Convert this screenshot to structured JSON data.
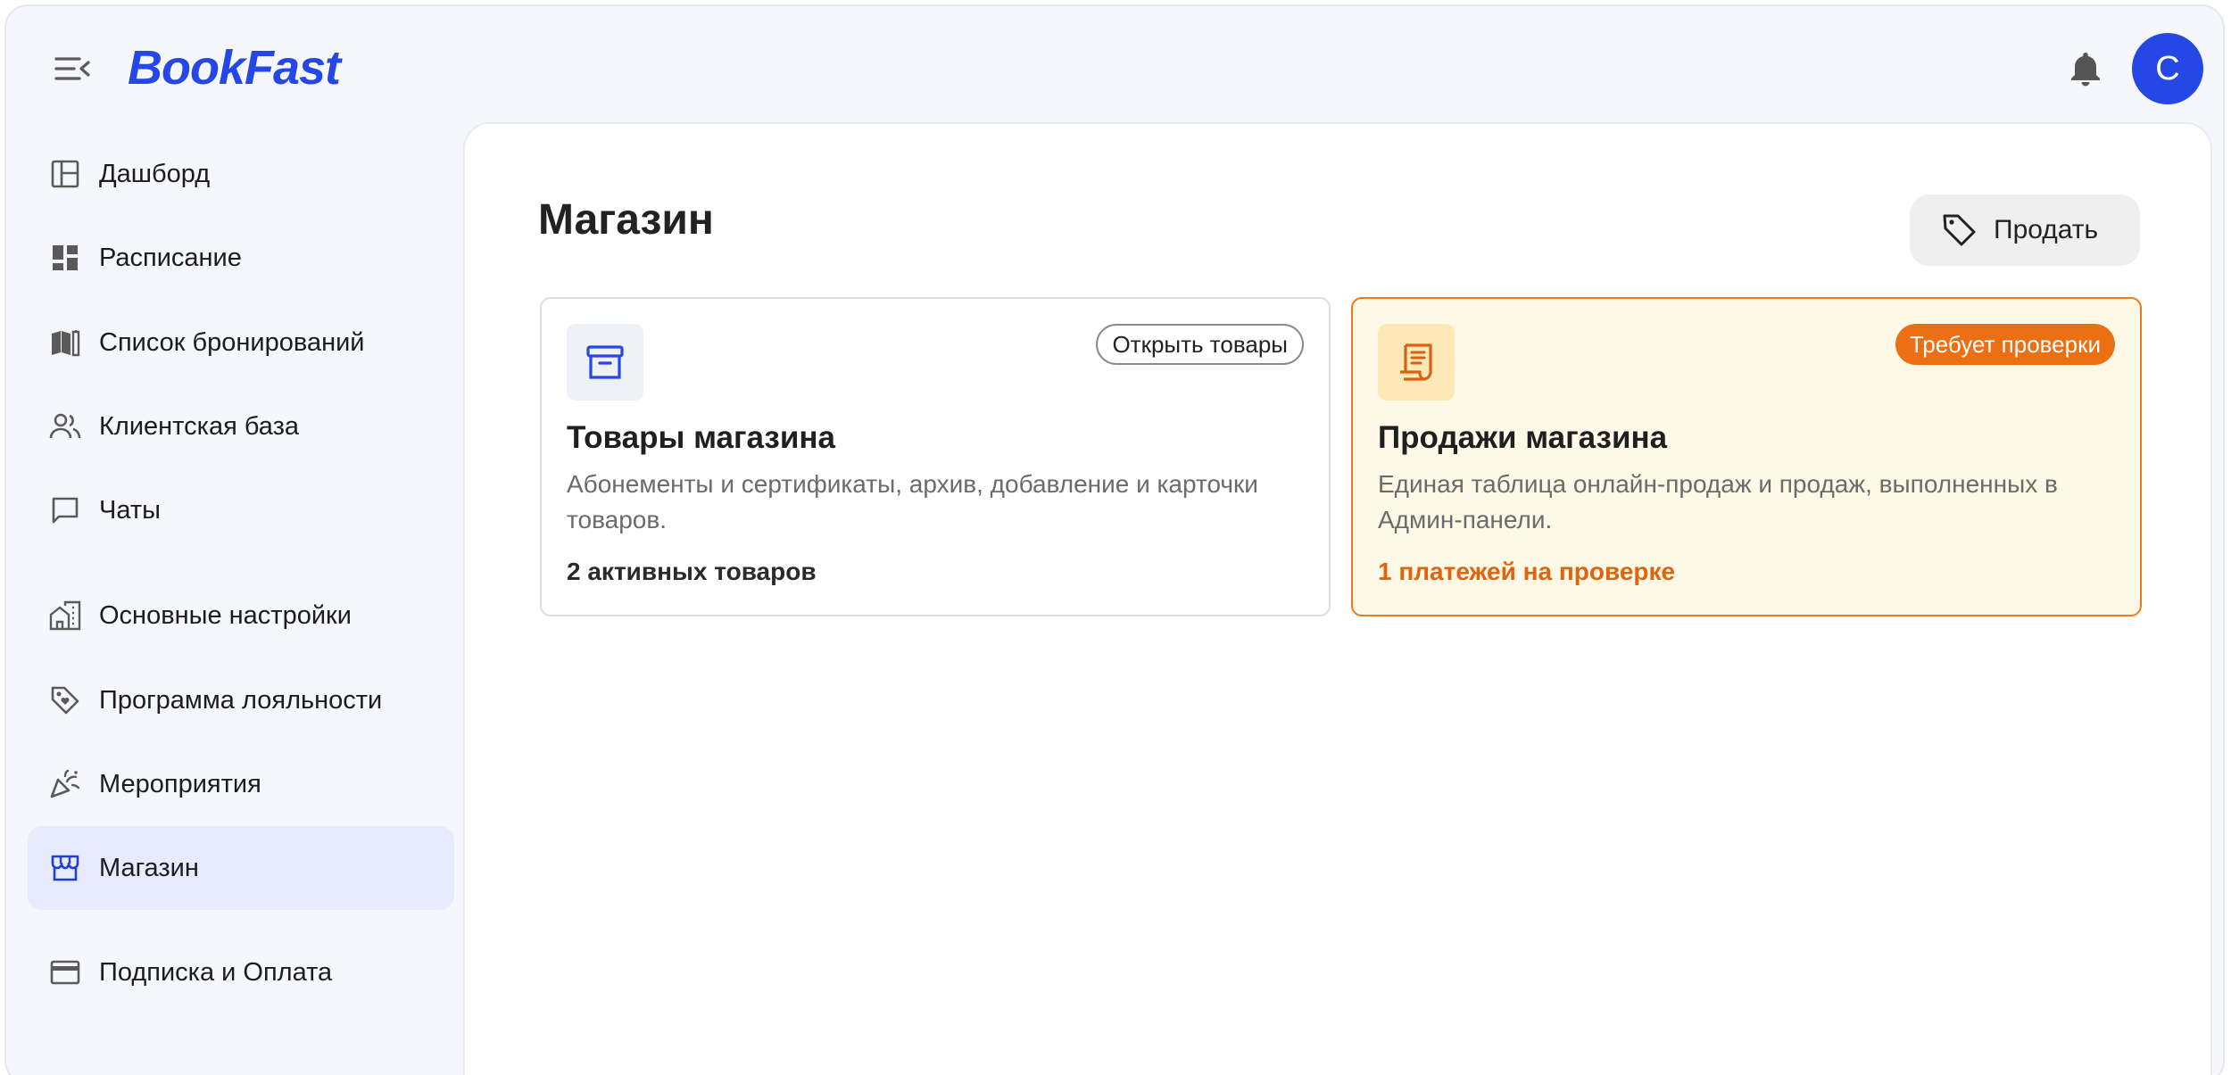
{
  "app": {
    "logo_text": "BookFast",
    "avatar_initial": "C"
  },
  "sidebar": {
    "items": [
      {
        "label": "Дашборд",
        "icon": "dashboard-icon"
      },
      {
        "label": "Расписание",
        "icon": "schedule-grid-icon"
      },
      {
        "label": "Список бронирований",
        "icon": "bookings-list-icon"
      },
      {
        "label": "Клиентская база",
        "icon": "clients-icon"
      },
      {
        "label": "Чаты",
        "icon": "chat-icon"
      },
      {
        "label": "Основные настройки",
        "icon": "building-settings-icon"
      },
      {
        "label": "Программа лояльности",
        "icon": "loyalty-tag-icon"
      },
      {
        "label": "Мероприятия",
        "icon": "party-popper-icon"
      },
      {
        "label": "Магазин",
        "icon": "store-icon",
        "active": true
      },
      {
        "label": "Подписка и Оплата",
        "icon": "credit-card-icon"
      }
    ]
  },
  "main": {
    "title": "Магазин",
    "sell_button": {
      "label": "Продать",
      "icon": "price-tag-icon"
    },
    "cards": {
      "goods": {
        "icon": "archive-box-icon",
        "chip": "Открыть товары",
        "title": "Товары магазина",
        "description": "Абонементы и сертификаты, архив, добавление и карточки товаров.",
        "stat": "2 активных товаров"
      },
      "sales": {
        "icon": "receipt-icon",
        "chip": "Требует проверки",
        "title": "Продажи магазина",
        "description": "Единая таблица онлайн-продаж и продаж, выполненных в Админ-панели.",
        "stat": "1 платежей на проверке"
      }
    }
  },
  "colors": {
    "accent": "#2547e6",
    "warning": "#ec6f14",
    "warning_bg": "#fef9e6",
    "active_nav_bg": "#e7ebfd"
  }
}
